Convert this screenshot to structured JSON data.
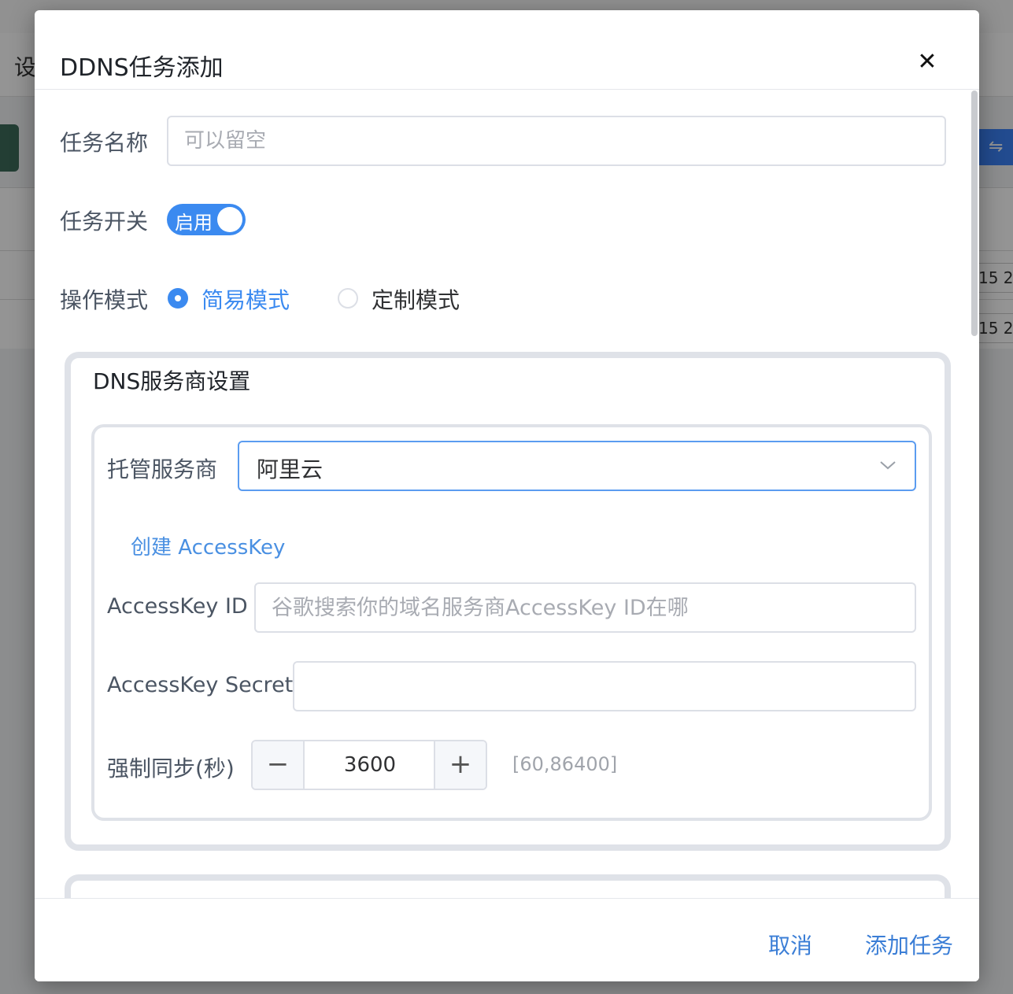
{
  "background": {
    "header_text": "设",
    "cells": [
      "15 2",
      "15 2"
    ]
  },
  "dialog": {
    "title": "DDNS任务添加",
    "close_symbol": "✕",
    "task_name": {
      "label": "任务名称",
      "placeholder": "可以留空",
      "value": ""
    },
    "task_switch": {
      "label": "任务开关",
      "state_text": "启用",
      "enabled": true
    },
    "mode": {
      "label": "操作模式",
      "options": [
        {
          "label": "简易模式",
          "selected": true
        },
        {
          "label": "定制模式",
          "selected": false
        }
      ]
    },
    "dns_section": {
      "title": "DNS服务商设置",
      "provider": {
        "label": "托管服务商",
        "value": "阿里云"
      },
      "create_link": "创建 AccessKey",
      "access_key_id": {
        "label": "AccessKey ID",
        "placeholder": "谷歌搜索你的域名服务商AccessKey ID在哪",
        "value": ""
      },
      "access_key_secret": {
        "label": "AccessKey Secret",
        "value": ""
      },
      "force_sync": {
        "label": "强制同步(秒)",
        "value": "3600",
        "minus": "−",
        "plus": "+",
        "range_hint": "[60,86400]"
      }
    },
    "footer": {
      "cancel_label": "取消",
      "submit_label": "添加任务"
    }
  },
  "colors": {
    "accent": "#3b8af0",
    "link": "#4a90e2",
    "border": "#dcdfe6",
    "section_border": "#dfe2e8"
  }
}
